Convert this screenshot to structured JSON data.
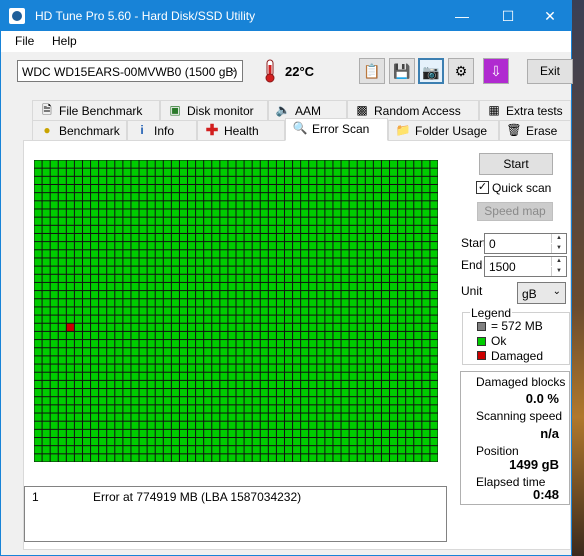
{
  "window": {
    "title": "HD Tune Pro 5.60 - Hard Disk/SSD Utility"
  },
  "menu": {
    "file": "File",
    "help": "Help"
  },
  "toolbar": {
    "drive": "WDC WD15EARS-00MVWB0 (1500 gB)",
    "temperature": "22°C",
    "buttons": [
      "copy-info-icon",
      "save-icon",
      "screenshot-icon",
      "options-icon",
      "download-icon"
    ],
    "exit_label": "Exit"
  },
  "tabs_top": [
    {
      "label": "File Benchmark",
      "icon": "file-benchmark-icon"
    },
    {
      "label": "Disk monitor",
      "icon": "disk-monitor-icon"
    },
    {
      "label": "AAM",
      "icon": "aam-speaker-icon"
    },
    {
      "label": "Random Access",
      "icon": "random-access-icon"
    },
    {
      "label": "Extra tests",
      "icon": "extra-tests-icon"
    }
  ],
  "tabs_bottom": [
    {
      "label": "Benchmark",
      "icon": "benchmark-icon"
    },
    {
      "label": "Info",
      "icon": "info-icon"
    },
    {
      "label": "Health",
      "icon": "health-cross-icon"
    },
    {
      "label": "Error Scan",
      "icon": "magnifier-icon",
      "selected": true
    },
    {
      "label": "Folder Usage",
      "icon": "folder-icon"
    },
    {
      "label": "Erase",
      "icon": "trash-icon"
    }
  ],
  "controls": {
    "start_label": "Start",
    "quick_scan_label": "Quick scan",
    "quick_scan_checked": true,
    "speed_map_label": "Speed map",
    "start_field_label": "Start",
    "start_value": "0",
    "end_field_label": "End",
    "end_value": "1500",
    "unit_label": "Unit",
    "unit_value": "gB"
  },
  "legend": {
    "title": "Legend",
    "items": [
      {
        "label": "= 572 MB",
        "color": "#808080"
      },
      {
        "label": "Ok",
        "color": "#00cc00"
      },
      {
        "label": "Damaged",
        "color": "#cc0000"
      }
    ]
  },
  "stats": {
    "damaged_blocks_label": "Damaged blocks",
    "damaged_blocks_value": "0.0 %",
    "scanning_speed_label": "Scanning speed",
    "scanning_speed_value": "n/a",
    "position_label": "Position",
    "position_value": "1499 gB",
    "elapsed_label": "Elapsed time",
    "elapsed_value": "0:48"
  },
  "error_log": [
    {
      "index": "1",
      "message": "Error at 774919 MB (LBA 1587034232)"
    }
  ],
  "scan_grid": {
    "columns": 50,
    "rows": 37,
    "damaged": [
      {
        "row": 20,
        "col": 4
      }
    ],
    "ok_color": "#00cc00",
    "damaged_color": "#cc0000"
  }
}
